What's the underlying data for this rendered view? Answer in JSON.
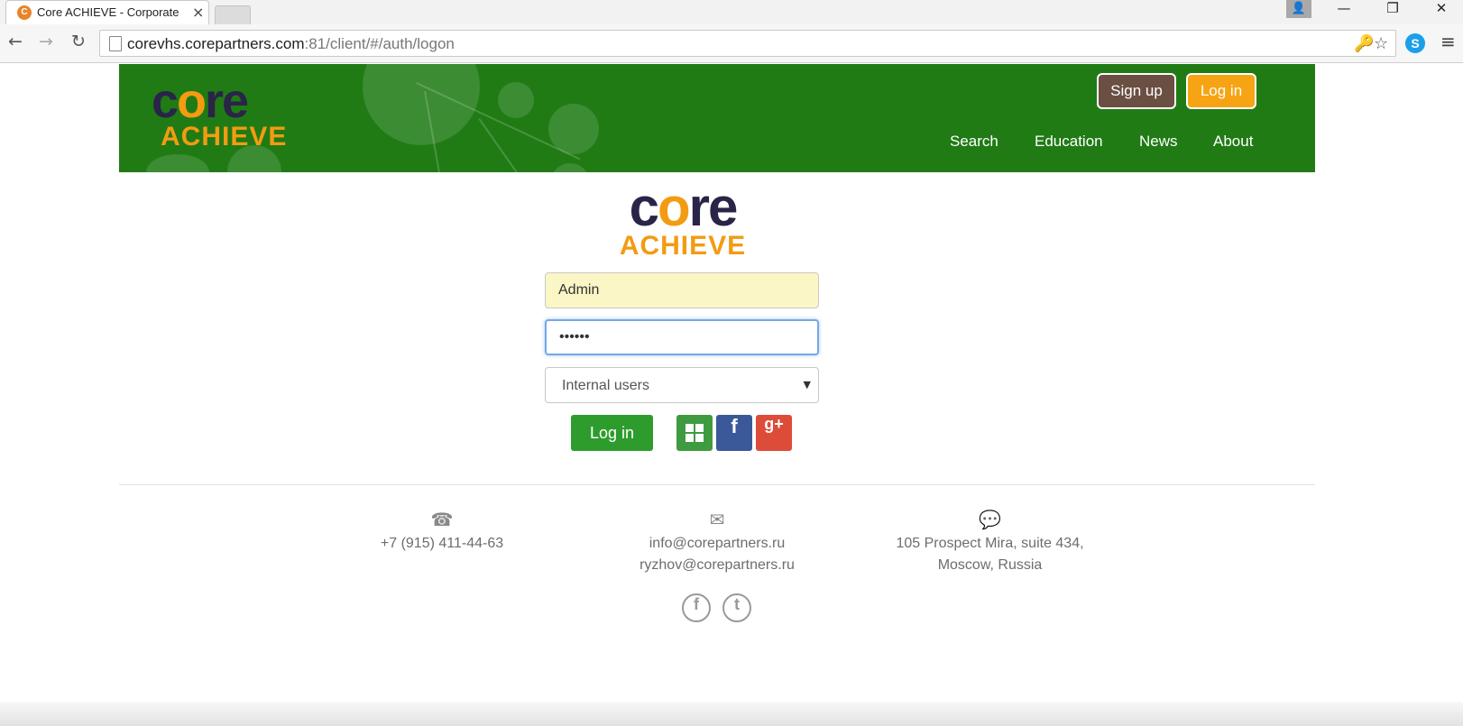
{
  "browser": {
    "tab_title": "Core ACHIEVE - Corporate",
    "tab_close": "×",
    "url_host": "corevhs.corepartners.com",
    "url_path": ":81/client/#/auth/logon",
    "minimize": "—",
    "restore": "❐",
    "close": "✕",
    "back": "←",
    "forward": "→",
    "reload": "↻",
    "key_icon": "🔑",
    "star_icon": "☆",
    "menu_icon": "≡",
    "skype": "S"
  },
  "header": {
    "logo_part1": "c",
    "logo_o": "o",
    "logo_part2": "re",
    "logo_sub": "ACHIEVE",
    "signup_label": "Sign up",
    "login_label": "Log in",
    "nav": {
      "search": "Search",
      "education": "Education",
      "news": "News",
      "about": "About"
    }
  },
  "login": {
    "logo_part1": "c",
    "logo_o": "o",
    "logo_part2": "re",
    "logo_sub": "ACHIEVE",
    "username_value": "Admin",
    "password_value": "••••••",
    "user_type": "Internal users",
    "caret": "▼",
    "submit_label": "Log in",
    "facebook_glyph": "f",
    "google_glyph": "g+"
  },
  "footer": {
    "phone_icon": "☎",
    "phone": "+7 (915) 411-44-63",
    "mail_icon": "✉",
    "email1": "info@corepartners.ru",
    "email2": "ryzhov@corepartners.ru",
    "chat_icon": "💬",
    "address_line1": "105 Prospect Mira, suite 434,",
    "address_line2": "Moscow, Russia",
    "facebook_glyph": "f",
    "twitter_glyph": "t"
  }
}
